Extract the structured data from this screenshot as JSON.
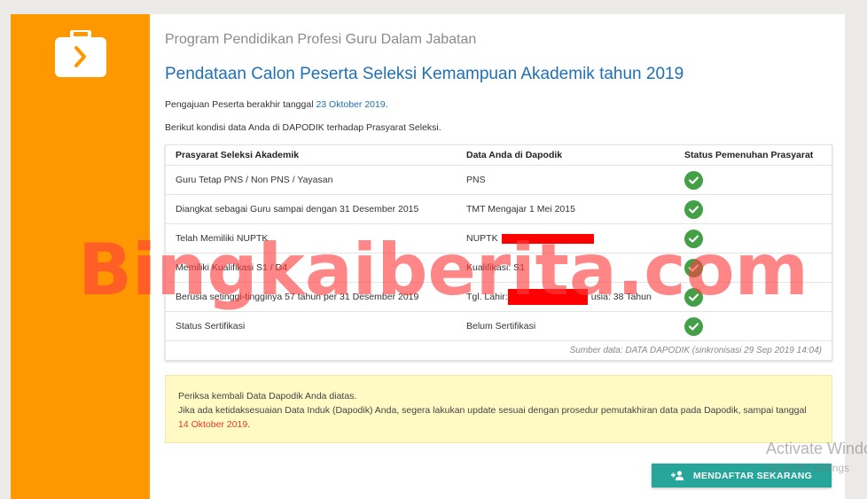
{
  "header": {
    "subtitle": "Program Pendidikan Profesi Guru Dalam Jabatan",
    "title": "Pendataan Calon Peserta Seleksi Kemampuan Akademik tahun 2019"
  },
  "intro": {
    "deadline_text": "Pengajuan Peserta berakhir tanggal ",
    "deadline_date": "23 Oktober 2019",
    "deadline_end": ".",
    "condition_text": "Berikut kondisi data Anda di DAPODIK terhadap Prasyarat Seleksi."
  },
  "table": {
    "headers": [
      "Prasyarat Seleksi Akademik",
      "Data Anda di Dapodik",
      "Status Pemenuhan Prasyarat"
    ],
    "rows": [
      {
        "req": "Guru Tetap PNS / Non PNS / Yayasan",
        "data": "PNS",
        "status": "check"
      },
      {
        "req": "Diangkat sebagai Guru sampai dengan 31 Desember 2015",
        "data": "TMT Mengajar 1 Mei 2015",
        "status": "check"
      },
      {
        "req": "Telah Memiliki NUPTK",
        "data": "NUPTK",
        "status": "check"
      },
      {
        "req": "Memiliki Kualifikasi S1 / D4",
        "data": "Kualifikasi: S1",
        "status": "check"
      },
      {
        "req": "Berusia setinggi-tingginya 57 tahun per 31 Desember 2019",
        "data": "Tgl. Lahir:",
        "data_after": "usia: 38 Tahun",
        "status": "check"
      },
      {
        "req": "Status Sertifikasi",
        "data": "Belum Sertifikasi",
        "status": "check"
      }
    ],
    "source": "Sumber data: DATA DAPODIK (sinkronisasi 29 Sep 2019 14:04)"
  },
  "notice": {
    "line1": "Periksa kembali Data Dapodik Anda diatas.",
    "line2": "Jika ada ketidaksesuaian Data Induk (Dapodik) Anda, segera lakukan update sesuai dengan prosedur pemutakhiran data pada Dapodik, sampai tanggal ",
    "date": "14 Oktober 2019",
    "end": "."
  },
  "register_button": {
    "label": "MENDAFTAR SEKARANG",
    "icon": "person-add-icon"
  },
  "watermark": "Bingkaiberita.com",
  "os_overlay": {
    "line1": "Activate Windows",
    "line2": "Go to PC settings"
  },
  "colors": {
    "sidebar": "#ff9800",
    "title": "#1f6fb4",
    "check": "#43a047",
    "button": "#26a69a",
    "notice_bg": "#fff9c4"
  }
}
